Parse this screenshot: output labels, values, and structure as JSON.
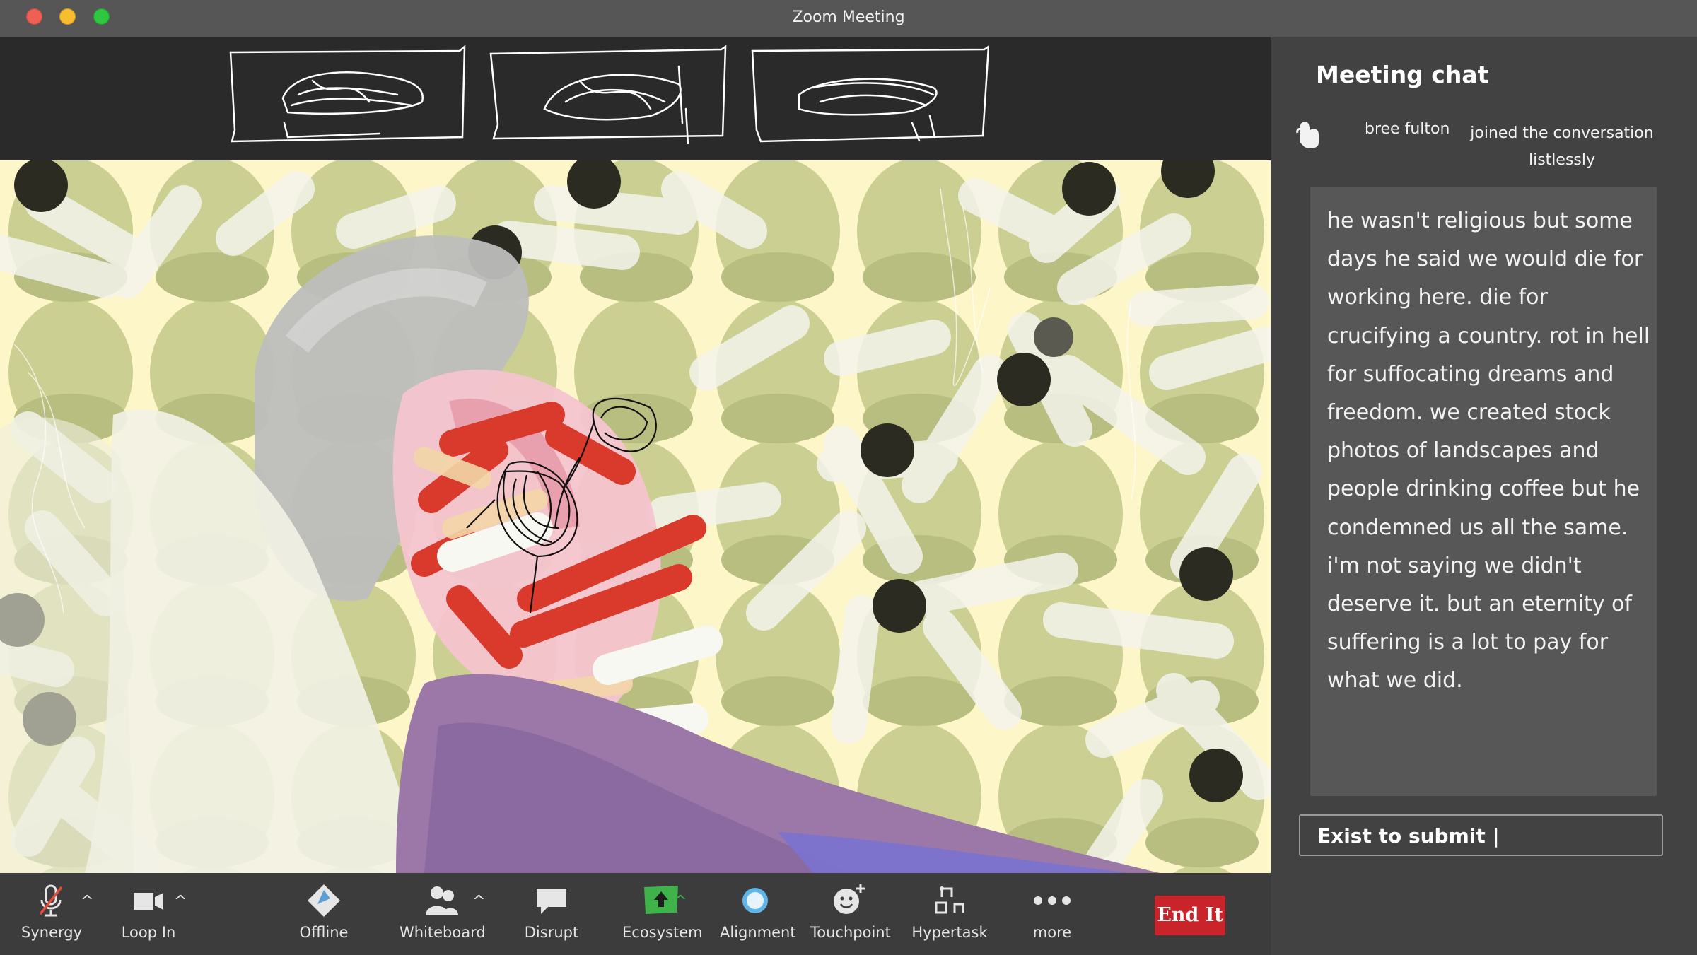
{
  "window": {
    "title": "Zoom Meeting"
  },
  "chat": {
    "title": "Meeting chat",
    "join_name": "bree fulton",
    "join_text": "joined the conversation listlessly",
    "message": "he wasn't religious but some days he said we would die for working here. die for crucifying a country. rot in hell for suffocating dreams and freedom. we created stock photos of landscapes and people drinking coffee but he condemned us all the same. i'm not saying we didn't deserve it. but an eternity of suffering is a lot to pay for what we did.",
    "input_value": "Exist to submit |"
  },
  "toolbar": {
    "items": [
      {
        "label": "Synergy",
        "icon": "microphone-muted-icon"
      },
      {
        "label": "Loop In",
        "icon": "video-camera-icon"
      },
      {
        "label": "Offline",
        "icon": "share-diamond-icon"
      },
      {
        "label": "Whiteboard",
        "icon": "participants-icon"
      },
      {
        "label": "Disrupt",
        "icon": "chat-bubble-icon"
      },
      {
        "label": "Ecosystem",
        "icon": "share-screen-icon"
      },
      {
        "label": "Alignment",
        "icon": "record-circle-icon"
      },
      {
        "label": "Touchpoint",
        "icon": "reaction-smiley-icon"
      },
      {
        "label": "Hypertask",
        "icon": "apps-icon"
      },
      {
        "label": "more",
        "icon": "more-dots-icon"
      }
    ],
    "end_label": "End It"
  },
  "colors": {
    "end_button": "#c9242a",
    "share_green": "#3fb24a",
    "panel_bg": "#424242",
    "title_bar": "#565656"
  }
}
